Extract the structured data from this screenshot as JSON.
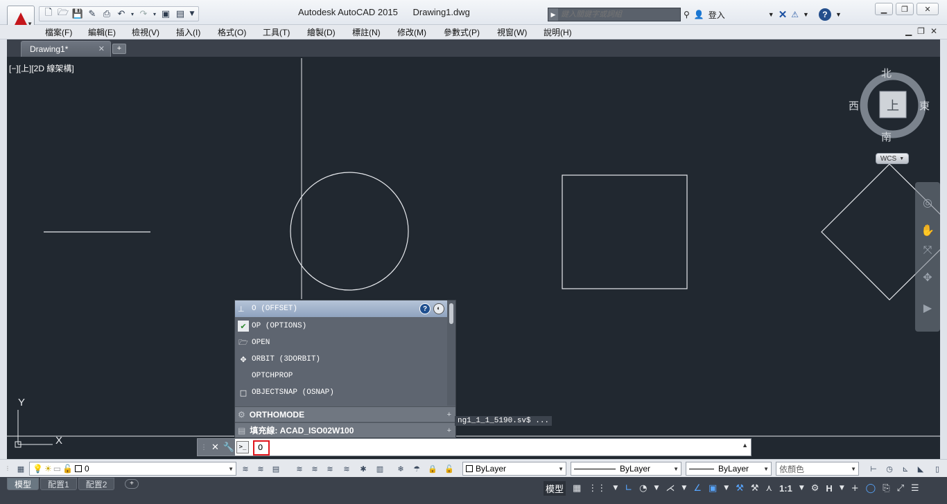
{
  "app": {
    "title": "Autodesk AutoCAD 2015",
    "file": "Drawing1.dwg"
  },
  "search": {
    "placeholder": "鍵入關鍵字或詞組"
  },
  "user": {
    "sign_in": "登入"
  },
  "menu": [
    "檔案(F)",
    "編輯(E)",
    "檢視(V)",
    "插入(I)",
    "格式(O)",
    "工具(T)",
    "繪製(D)",
    "標註(N)",
    "修改(M)",
    "參數式(P)",
    "視窗(W)",
    "說明(H)"
  ],
  "tabs": {
    "doc": "Drawing1*"
  },
  "viewport": {
    "label": "[−][上][2D 線架構]"
  },
  "viewcube": {
    "north": "北",
    "south": "南",
    "west": "西",
    "east": "東",
    "face": "上",
    "wcs": "WCS"
  },
  "ucs": {
    "y": "Y",
    "x": "X"
  },
  "autocomplete": {
    "header": "O (OFFSET)",
    "items": [
      {
        "label": "OP (OPTIONS)",
        "icon": "options-icon"
      },
      {
        "label": "OPEN",
        "icon": "open-folder-icon"
      },
      {
        "label": "ORBIT (3DORBIT)",
        "icon": "orbit-icon"
      },
      {
        "label": "OPTCHPROP",
        "icon": ""
      },
      {
        "label": "OBJECTSNAP (OSNAP)",
        "icon": "osnap-icon"
      }
    ],
    "sections": [
      {
        "label": "ORTHOMODE",
        "icon": "gear-icon"
      },
      {
        "label": "填充線: ACAD_ISO02W100",
        "icon": "hatch-icon"
      }
    ]
  },
  "history": {
    "text": "ng1_1_1_5190.sv$ ..."
  },
  "command": {
    "input": "O"
  },
  "layer": {
    "name": "0"
  },
  "properties": {
    "color": "ByLayer",
    "linetype": "ByLayer",
    "lineweight": "ByLayer",
    "plotstyle": "依顏色"
  },
  "layouts": [
    "模型",
    "配置1",
    "配置2"
  ],
  "status": {
    "model": "模型",
    "scale": "1:1",
    "annot": "H"
  },
  "colors": {
    "canvas": "#212830",
    "accent": "#58a6ff",
    "input_border": "#e0141b"
  }
}
